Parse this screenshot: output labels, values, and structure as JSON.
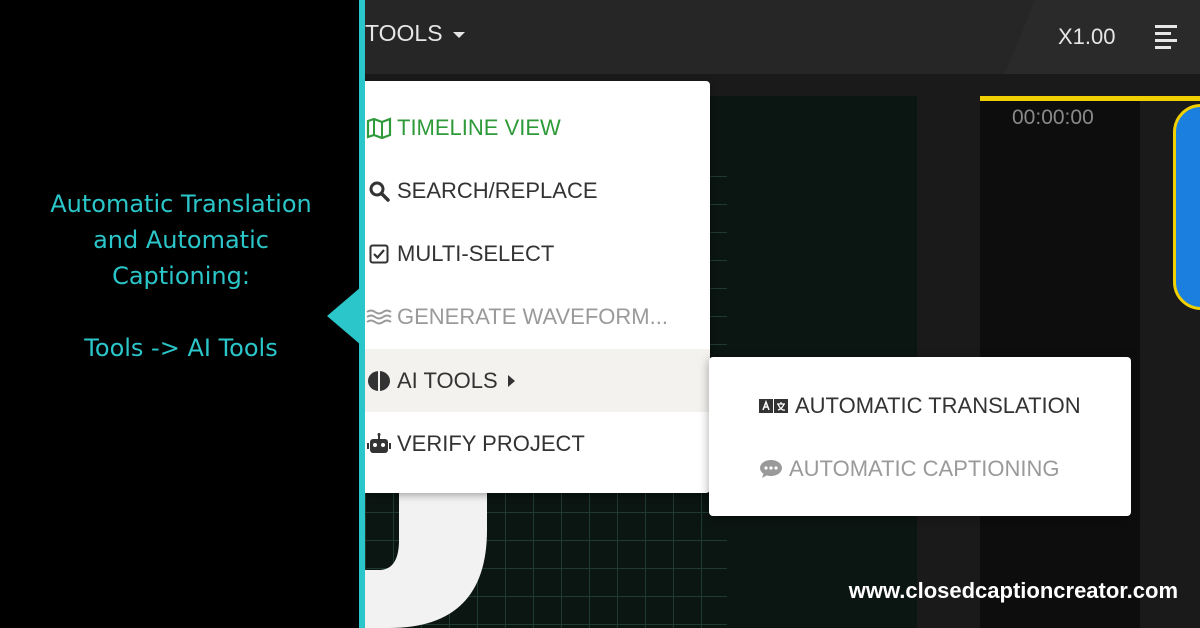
{
  "callout": {
    "title": "Automatic Translation and Automatic Captioning:",
    "path": "Tools -> AI Tools",
    "color": "#2bc6c9"
  },
  "app": {
    "tools_label": "TOOLS",
    "speed": "X1.00",
    "timecode": "00:00:00"
  },
  "tools_menu": {
    "items": [
      {
        "icon": "map-icon",
        "label": "TIMELINE VIEW"
      },
      {
        "icon": "search-icon",
        "label": "SEARCH/REPLACE"
      },
      {
        "icon": "checkbox-icon",
        "label": "MULTI-SELECT"
      },
      {
        "icon": "waveform-icon",
        "label": "GENERATE WAVEFORM..."
      },
      {
        "icon": "brain-icon",
        "label": "AI TOOLS"
      },
      {
        "icon": "robot-icon",
        "label": "VERIFY PROJECT"
      }
    ]
  },
  "ai_submenu": {
    "items": [
      {
        "icon": "language-icon",
        "label": "AUTOMATIC TRANSLATION"
      },
      {
        "icon": "comment-dots-icon",
        "label": "AUTOMATIC CAPTIONING"
      }
    ]
  },
  "website": "www.closedcaptioncreator.com"
}
